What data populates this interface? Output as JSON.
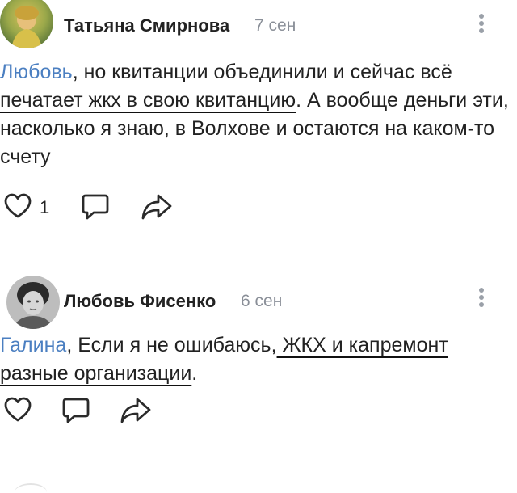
{
  "comments": [
    {
      "author": "Татьяна Смирнова",
      "date": "7 сен",
      "mention": "Любовь",
      "text_1": ", но квитанции объединили и сейчас всё ",
      "text_underlined": "печатает жкх в свою квитанцию",
      "text_2": ". А вообще деньги эти, насколько я знаю, в Волхове и остаются на каком-то счету",
      "like_count": "1",
      "icons": [
        "heart-icon",
        "comment-icon",
        "share-icon",
        "more-vertical-icon"
      ]
    },
    {
      "author": "Любовь Фисенко",
      "date": "6 сен",
      "mention": "Галина",
      "text_1": ", Если я не ошибаюсь,",
      "text_underlined_1": " ЖКХ и капремонт",
      "text_2": " ",
      "text_underlined_2": "разные организации",
      "text_3": ".",
      "icons": [
        "heart-icon",
        "comment-icon",
        "share-icon",
        "more-vertical-icon"
      ]
    }
  ],
  "colors": {
    "mention": "#4b7fc1",
    "date": "#8a8f98",
    "icon": "#2a2a2a",
    "text": "#222222"
  }
}
